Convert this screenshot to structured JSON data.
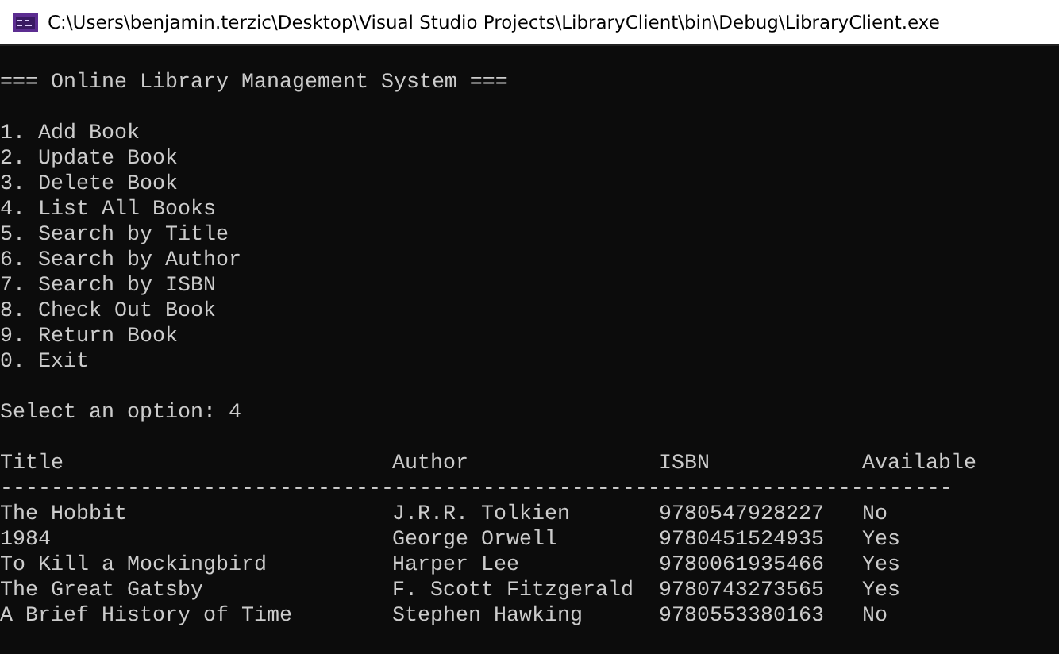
{
  "window": {
    "title": "C:\\Users\\benjamin.terzic\\Desktop\\Visual Studio Projects\\LibraryClient\\bin\\Debug\\LibraryClient.exe"
  },
  "console": {
    "heading": "=== Online Library Management System ===",
    "menu": [
      "1. Add Book",
      "2. Update Book",
      "3. Delete Book",
      "4. List All Books",
      "5. Search by Title",
      "6. Search by Author",
      "7. Search by ISBN",
      "8. Check Out Book",
      "9. Return Book",
      "0. Exit"
    ],
    "prompt": "Select an option: 4",
    "table": {
      "columns": [
        "Title",
        "Author",
        "ISBN",
        "Available"
      ],
      "divider": "---------------------------------------------------------------------------",
      "rows": [
        [
          "The Hobbit",
          "J.R.R. Tolkien",
          "9780547928227",
          "No"
        ],
        [
          "1984",
          "George Orwell",
          "9780451524935",
          "Yes"
        ],
        [
          "To Kill a Mockingbird",
          "Harper Lee",
          "9780061935466",
          "Yes"
        ],
        [
          "The Great Gatsby",
          "F. Scott Fitzgerald",
          "9780743273565",
          "Yes"
        ],
        [
          "A Brief History of Time",
          "Stephen Hawking",
          "9780553380163",
          "No"
        ]
      ]
    }
  }
}
